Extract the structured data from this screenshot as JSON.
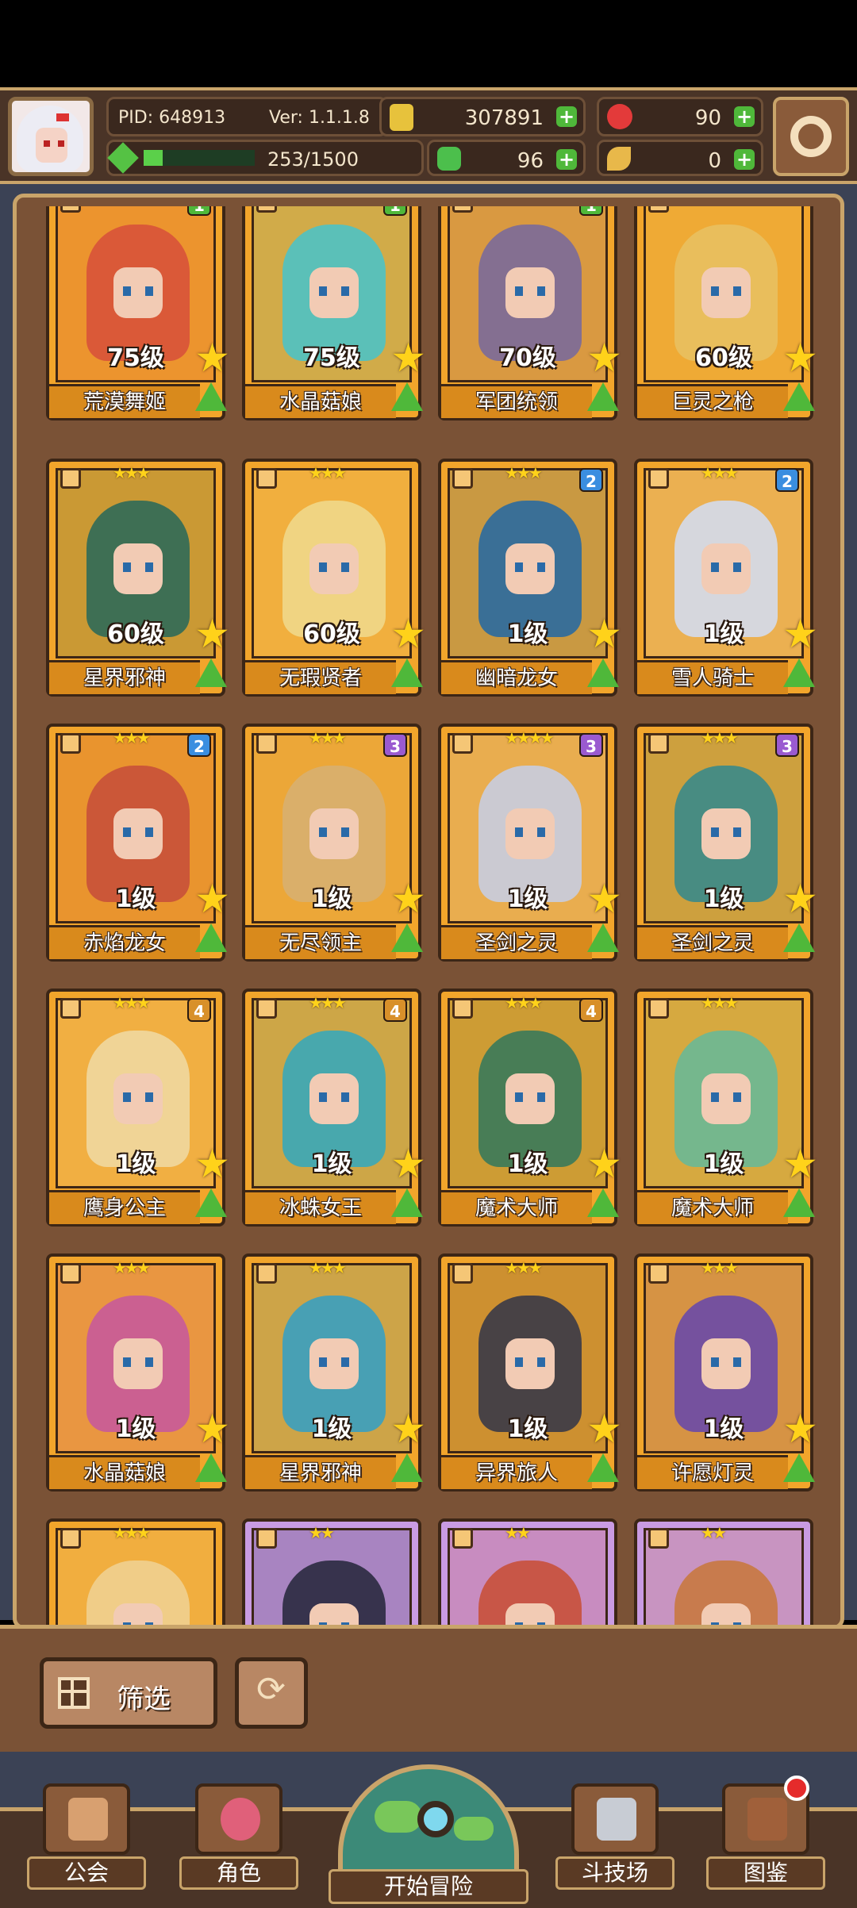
{
  "header": {
    "pid": "PID: 648913",
    "version": "Ver: 1.1.1.8",
    "gold": "307891",
    "ruby": "90",
    "exp_text": "253/1500",
    "exp_progress": 0.17,
    "clover": "96",
    "feather": "0"
  },
  "cards": [
    {
      "name": "荒漠舞姬",
      "level": "75级",
      "stars": "",
      "rank": "1",
      "color": "#d8523a"
    },
    {
      "name": "水晶菇娘",
      "level": "75级",
      "stars": "",
      "rank": "1",
      "color": "#4ec2c4"
    },
    {
      "name": "军团统领",
      "level": "70级",
      "stars": "",
      "rank": "1",
      "color": "#7a6a9a"
    },
    {
      "name": "巨灵之枪",
      "level": "60级",
      "stars": "",
      "rank": "",
      "color": "#e8c060"
    },
    {
      "name": "星界邪神",
      "level": "60级",
      "stars": "★★★",
      "rank": "",
      "color": "#2f6a58"
    },
    {
      "name": "无瑕贤者",
      "level": "60级",
      "stars": "★★★",
      "rank": "",
      "color": "#f0d88a"
    },
    {
      "name": "幽暗龙女",
      "level": "1级",
      "stars": "★★★",
      "rank": "2",
      "color": "#2a6aa0"
    },
    {
      "name": "雪人骑士",
      "level": "1级",
      "stars": "★★★",
      "rank": "2",
      "color": "#d4dcec"
    },
    {
      "name": "赤焰龙女",
      "level": "1级",
      "stars": "★★★",
      "rank": "2",
      "color": "#c8503a"
    },
    {
      "name": "无尽领主",
      "level": "1级",
      "stars": "★★★",
      "rank": "3",
      "color": "#d8b070"
    },
    {
      "name": "圣剑之灵",
      "level": "1级",
      "stars": "★★★★",
      "rank": "3",
      "color": "#c8cde0"
    },
    {
      "name": "圣剑之灵",
      "level": "1级",
      "stars": "★★★",
      "rank": "3",
      "color": "#3a8a8a"
    },
    {
      "name": "鹰身公主",
      "level": "1级",
      "stars": "★★★",
      "rank": "4",
      "color": "#f0d8a0"
    },
    {
      "name": "冰蛛女王",
      "level": "1级",
      "stars": "★★★",
      "rank": "4",
      "color": "#3aa8b8"
    },
    {
      "name": "魔术大师",
      "level": "1级",
      "stars": "★★★",
      "rank": "4",
      "color": "#3a7a5a"
    },
    {
      "name": "魔术大师",
      "level": "1级",
      "stars": "★★★",
      "rank": "",
      "color": "#6ab896"
    },
    {
      "name": "水晶菇娘",
      "level": "1级",
      "stars": "★★★",
      "rank": "",
      "color": "#c85a9a"
    },
    {
      "name": "星界邪神",
      "level": "1级",
      "stars": "★★★",
      "rank": "",
      "color": "#3aa0c0"
    },
    {
      "name": "异界旅人",
      "level": "1级",
      "stars": "★★★",
      "rank": "",
      "color": "#3a3a48"
    },
    {
      "name": "许愿灯灵",
      "level": "1级",
      "stars": "★★★",
      "rank": "",
      "color": "#6a4aa8"
    },
    {
      "name": "",
      "level": "",
      "stars": "★★★",
      "rank": "",
      "color": "#f0d090"
    },
    {
      "name": "",
      "level": "",
      "stars": "★★",
      "rank": "",
      "color": "#2a2a40"
    },
    {
      "name": "",
      "level": "",
      "stars": "★★",
      "rank": "",
      "color": "#c8503a"
    },
    {
      "name": "",
      "level": "",
      "stars": "★★",
      "rank": "",
      "color": "#c87840"
    }
  ],
  "filter": {
    "label": "筛选"
  },
  "nav": {
    "guild": "公会",
    "character": "角色",
    "adventure": "开始冒险",
    "arena": "斗技场",
    "codex": "图鉴"
  }
}
